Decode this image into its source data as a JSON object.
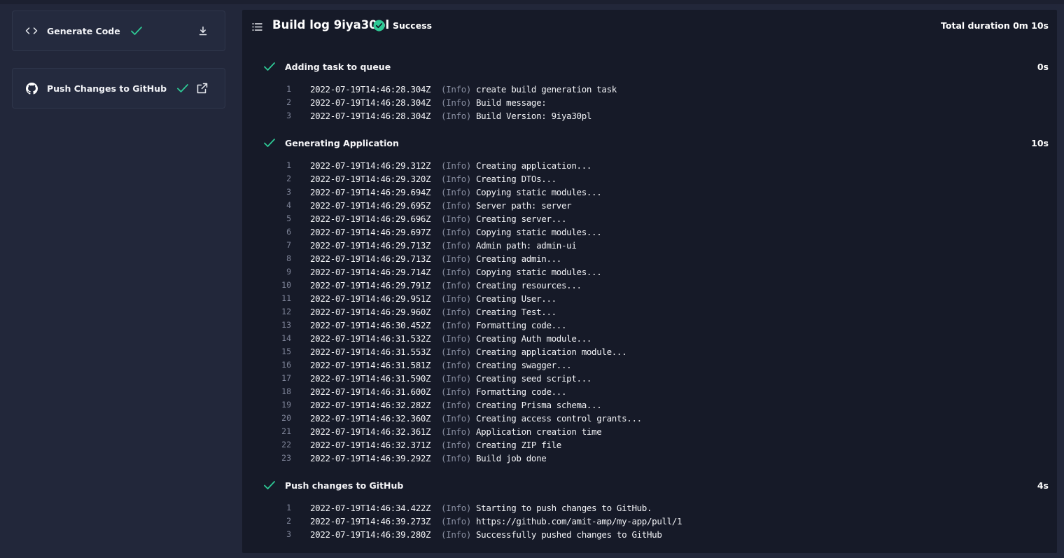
{
  "sidebar": {
    "cards": [
      {
        "label": "Generate Code",
        "icon": "code-icon",
        "status": "success",
        "action_icon": "download-icon"
      },
      {
        "label": "Push Changes to GitHub",
        "icon": "github-icon",
        "status": "success",
        "action_icon": "external-link-icon"
      }
    ]
  },
  "build_log": {
    "title": "Build log 9iya30pl",
    "status": "Success",
    "total_duration": "Total duration 0m 10s",
    "steps": [
      {
        "title": "Adding task to queue",
        "duration": "0s",
        "lines": [
          {
            "n": "1",
            "ts": "2022-07-19T14:46:28.304Z",
            "level": "(Info)",
            "msg": "create build generation task"
          },
          {
            "n": "2",
            "ts": "2022-07-19T14:46:28.304Z",
            "level": "(Info)",
            "msg": "Build message:"
          },
          {
            "n": "3",
            "ts": "2022-07-19T14:46:28.304Z",
            "level": "(Info)",
            "msg": "Build Version: 9iya30pl"
          }
        ]
      },
      {
        "title": "Generating Application",
        "duration": "10s",
        "lines": [
          {
            "n": "1",
            "ts": "2022-07-19T14:46:29.312Z",
            "level": "(Info)",
            "msg": "Creating application..."
          },
          {
            "n": "2",
            "ts": "2022-07-19T14:46:29.320Z",
            "level": "(Info)",
            "msg": "Creating DTOs..."
          },
          {
            "n": "3",
            "ts": "2022-07-19T14:46:29.694Z",
            "level": "(Info)",
            "msg": "Copying static modules..."
          },
          {
            "n": "4",
            "ts": "2022-07-19T14:46:29.695Z",
            "level": "(Info)",
            "msg": "Server path: server"
          },
          {
            "n": "5",
            "ts": "2022-07-19T14:46:29.696Z",
            "level": "(Info)",
            "msg": "Creating server..."
          },
          {
            "n": "6",
            "ts": "2022-07-19T14:46:29.697Z",
            "level": "(Info)",
            "msg": "Copying static modules..."
          },
          {
            "n": "7",
            "ts": "2022-07-19T14:46:29.713Z",
            "level": "(Info)",
            "msg": "Admin path: admin-ui"
          },
          {
            "n": "8",
            "ts": "2022-07-19T14:46:29.713Z",
            "level": "(Info)",
            "msg": "Creating admin..."
          },
          {
            "n": "9",
            "ts": "2022-07-19T14:46:29.714Z",
            "level": "(Info)",
            "msg": "Copying static modules..."
          },
          {
            "n": "10",
            "ts": "2022-07-19T14:46:29.791Z",
            "level": "(Info)",
            "msg": "Creating resources..."
          },
          {
            "n": "11",
            "ts": "2022-07-19T14:46:29.951Z",
            "level": "(Info)",
            "msg": "Creating User..."
          },
          {
            "n": "12",
            "ts": "2022-07-19T14:46:29.960Z",
            "level": "(Info)",
            "msg": "Creating Test..."
          },
          {
            "n": "13",
            "ts": "2022-07-19T14:46:30.452Z",
            "level": "(Info)",
            "msg": "Formatting code..."
          },
          {
            "n": "14",
            "ts": "2022-07-19T14:46:31.532Z",
            "level": "(Info)",
            "msg": "Creating Auth module..."
          },
          {
            "n": "15",
            "ts": "2022-07-19T14:46:31.553Z",
            "level": "(Info)",
            "msg": "Creating application module..."
          },
          {
            "n": "16",
            "ts": "2022-07-19T14:46:31.581Z",
            "level": "(Info)",
            "msg": "Creating swagger..."
          },
          {
            "n": "17",
            "ts": "2022-07-19T14:46:31.590Z",
            "level": "(Info)",
            "msg": "Creating seed script..."
          },
          {
            "n": "18",
            "ts": "2022-07-19T14:46:31.600Z",
            "level": "(Info)",
            "msg": "Formatting code..."
          },
          {
            "n": "19",
            "ts": "2022-07-19T14:46:32.282Z",
            "level": "(Info)",
            "msg": "Creating Prisma schema..."
          },
          {
            "n": "20",
            "ts": "2022-07-19T14:46:32.360Z",
            "level": "(Info)",
            "msg": "Creating access control grants..."
          },
          {
            "n": "21",
            "ts": "2022-07-19T14:46:32.361Z",
            "level": "(Info)",
            "msg": "Application creation time"
          },
          {
            "n": "22",
            "ts": "2022-07-19T14:46:32.371Z",
            "level": "(Info)",
            "msg": "Creating ZIP file"
          },
          {
            "n": "23",
            "ts": "2022-07-19T14:46:39.292Z",
            "level": "(Info)",
            "msg": "Build job done"
          }
        ]
      },
      {
        "title": "Push changes to GitHub",
        "duration": "4s",
        "lines": [
          {
            "n": "1",
            "ts": "2022-07-19T14:46:34.422Z",
            "level": "(Info)",
            "msg": "Starting to push changes to GitHub."
          },
          {
            "n": "2",
            "ts": "2022-07-19T14:46:39.273Z",
            "level": "(Info)",
            "msg": "https://github.com/amit-amp/my-app/pull/1"
          },
          {
            "n": "3",
            "ts": "2022-07-19T14:46:39.280Z",
            "level": "(Info)",
            "msg": "Successfully pushed changes to GitHub"
          }
        ]
      }
    ]
  },
  "colors": {
    "success": "#2ec995",
    "panel_bg": "#161a28",
    "page_bg": "#22273a",
    "card_bg": "#242a3e"
  }
}
